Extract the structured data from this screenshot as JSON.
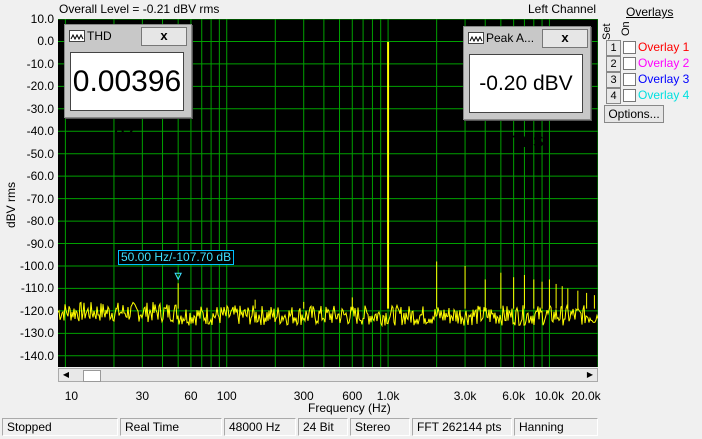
{
  "header": {
    "overall_level": "Overall Level = -0.21 dBV rms",
    "channel": "Left Channel"
  },
  "overlays": {
    "title": "Overlays",
    "set_label": "Set",
    "on_label": "On",
    "items": [
      {
        "num": "1",
        "label": "Overlay 1",
        "color": "#ff0000"
      },
      {
        "num": "2",
        "label": "Overlay 2",
        "color": "#ff00ff"
      },
      {
        "num": "3",
        "label": "Overlay 3",
        "color": "#0000ff"
      },
      {
        "num": "4",
        "label": "Overlay 4",
        "color": "#00e0e0"
      }
    ],
    "options_label": "Options..."
  },
  "meters": {
    "thd": {
      "title": "THD",
      "value": "0.00396 %",
      "close": "x"
    },
    "peak": {
      "title": "Peak A...",
      "value": "-0.20 dBV rms",
      "close": "x"
    }
  },
  "marker": {
    "label": "50.00 Hz/-107.70 dB",
    "freq": 50,
    "level": -107.7
  },
  "status": [
    "Stopped",
    "Real Time",
    "48000 Hz",
    "24 Bit",
    "Stereo",
    "FFT 262144 pts",
    "Hanning"
  ],
  "chart_data": {
    "type": "line",
    "xlabel": "Frequency (Hz)",
    "ylabel": "dBV rms",
    "xscale": "log",
    "xlim": [
      9,
      20000
    ],
    "ylim": [
      -145,
      10
    ],
    "yticks": [
      "10.0",
      "0.0",
      "-10.0",
      "-20.0",
      "-30.0",
      "-40.0",
      "-50.0",
      "-60.0",
      "-70.0",
      "-80.0",
      "-90.0",
      "-100.0",
      "-110.0",
      "-120.0",
      "-130.0",
      "-140.0"
    ],
    "ytick_values": [
      10,
      0,
      -10,
      -20,
      -30,
      -40,
      -50,
      -60,
      -70,
      -80,
      -90,
      -100,
      -110,
      -120,
      -130,
      -140
    ],
    "xticks": [
      {
        "label": "10",
        "value": 10
      },
      {
        "label": "30",
        "value": 30
      },
      {
        "label": "60",
        "value": 60
      },
      {
        "label": "100",
        "value": 100
      },
      {
        "label": "300",
        "value": 300
      },
      {
        "label": "600",
        "value": 600
      },
      {
        "label": "1.0k",
        "value": 1000
      },
      {
        "label": "3.0k",
        "value": 3000
      },
      {
        "label": "6.0k",
        "value": 6000
      },
      {
        "label": "10.0k",
        "value": 10000
      },
      {
        "label": "20.0k",
        "value": 20000
      }
    ],
    "grid": true,
    "line_color": "#ffff00",
    "grid_color": "#00a000",
    "noise_floor": -122,
    "peaks": [
      {
        "x": 1000,
        "y": -0.2
      },
      {
        "x": 2000,
        "y": -98
      },
      {
        "x": 3000,
        "y": -100
      },
      {
        "x": 4000,
        "y": -106
      },
      {
        "x": 5000,
        "y": -103
      },
      {
        "x": 6000,
        "y": -105
      },
      {
        "x": 7000,
        "y": -104
      },
      {
        "x": 8000,
        "y": -106
      },
      {
        "x": 9000,
        "y": -107
      },
      {
        "x": 10000,
        "y": -106
      },
      {
        "x": 11000,
        "y": -108
      },
      {
        "x": 12000,
        "y": -109
      },
      {
        "x": 13000,
        "y": -110
      },
      {
        "x": 15000,
        "y": -111
      },
      {
        "x": 17000,
        "y": -112
      },
      {
        "x": 19000,
        "y": -113
      },
      {
        "x": 50,
        "y": -107.7
      },
      {
        "x": 150,
        "y": -115
      },
      {
        "x": 600,
        "y": -114
      },
      {
        "x": 300,
        "y": -116
      }
    ]
  }
}
